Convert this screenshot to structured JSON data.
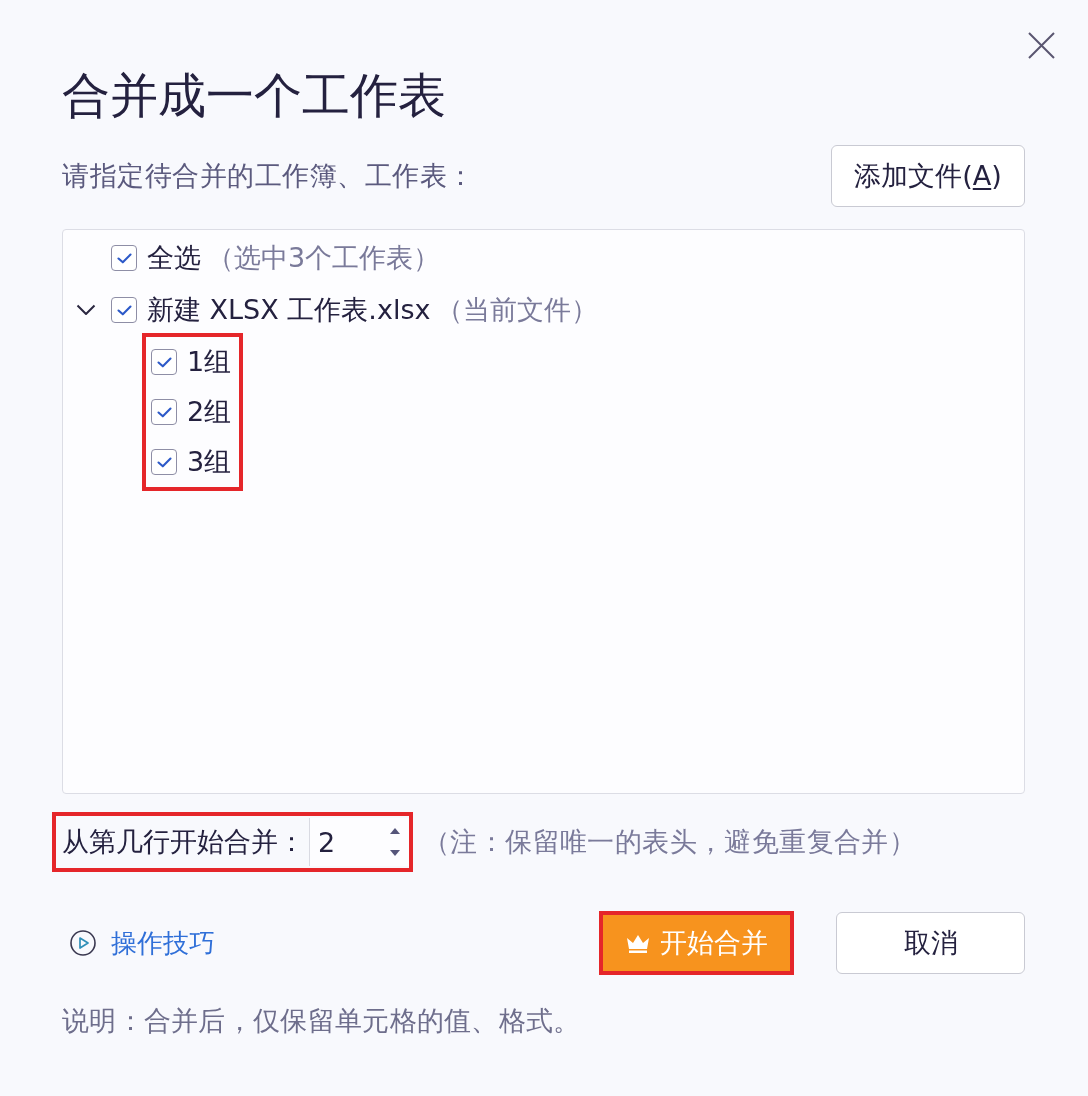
{
  "dialog": {
    "title": "合并成一个工作表"
  },
  "source": {
    "prompt": "请指定待合并的工作簿、工作表：",
    "add_button": [
      {
        "text": "添加文件(",
        "underline": false
      },
      {
        "text": "A",
        "underline": true
      },
      {
        "text": ")",
        "underline": false
      }
    ]
  },
  "tree": {
    "select_all": {
      "label": "全选",
      "note": "（选中3个工作表）",
      "checked": true
    },
    "files": [
      {
        "name": "新建 XLSX 工作表.xlsx",
        "note": "（当前文件）",
        "checked": true,
        "expanded": true,
        "children_highlighted": true,
        "children": [
          {
            "label": "1组",
            "checked": true
          },
          {
            "label": "2组",
            "checked": true
          },
          {
            "label": "3组",
            "checked": true
          }
        ]
      }
    ]
  },
  "start_row": {
    "label": "从第几行开始合并：",
    "value": "2",
    "note": "（注：保留唯一的表头，避免重复合并）",
    "highlighted": true
  },
  "tips_link": {
    "label": "操作技巧"
  },
  "buttons": [
    {
      "kind": "primary",
      "label": "开始合并",
      "highlighted": true
    },
    {
      "kind": "secondary",
      "label": "取消",
      "highlighted": false
    }
  ],
  "footnote": "说明：合并后，仅保留单元格的值、格式。"
}
